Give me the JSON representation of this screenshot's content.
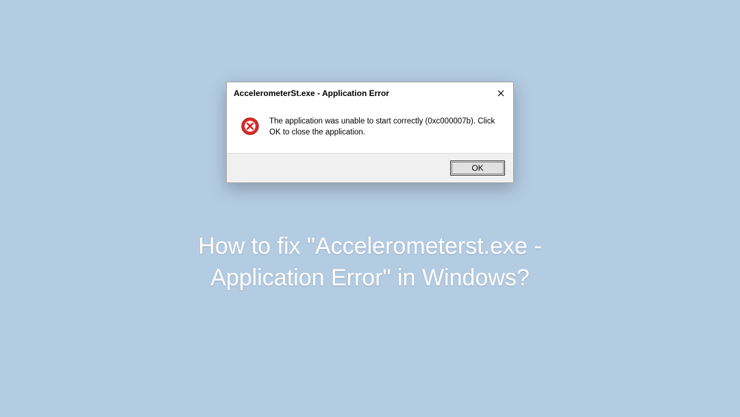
{
  "dialog": {
    "title": "AccelerometerSt.exe - Application Error",
    "message": "The application was unable to start correctly (0xc000007b). Click OK to close the application.",
    "ok_label": "OK"
  },
  "headline": {
    "line1": "How to fix \"Accelerometerst.exe -",
    "line2": "Application Error\" in Windows?"
  }
}
